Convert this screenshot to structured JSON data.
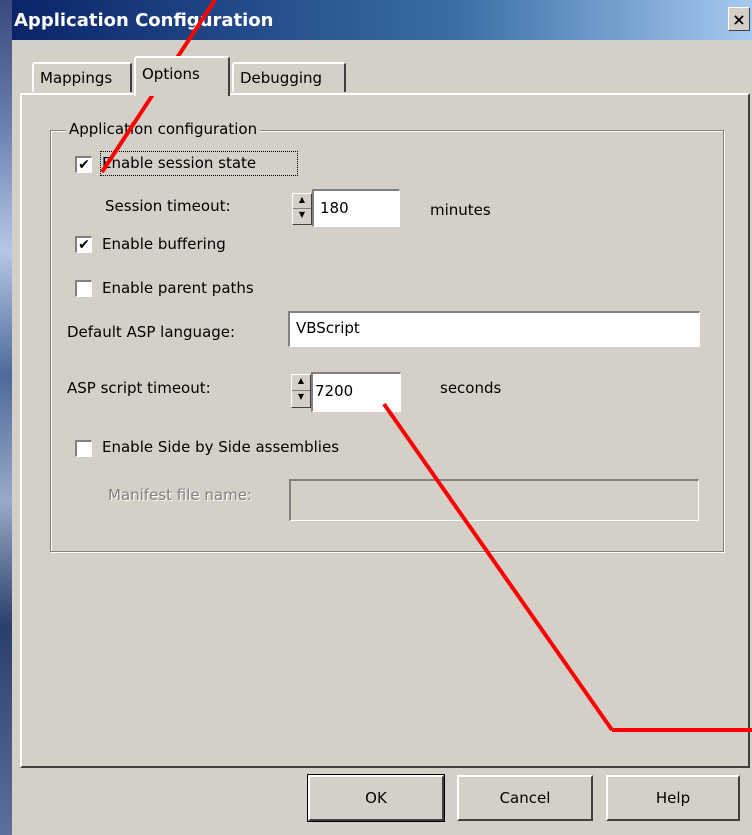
{
  "window": {
    "title": "Application Configuration",
    "close_label": "×"
  },
  "tabs": [
    {
      "label": "Mappings",
      "active": false
    },
    {
      "label": "Options",
      "active": true
    },
    {
      "label": "Debugging",
      "active": false
    }
  ],
  "group": {
    "legend": "Application configuration",
    "enable_session_state": {
      "label": "Enable session state",
      "checked": true
    },
    "session_timeout": {
      "label": "Session timeout:",
      "value": "180",
      "unit": "minutes"
    },
    "enable_buffering": {
      "label": "Enable buffering",
      "checked": true
    },
    "enable_parent_paths": {
      "label": "Enable parent paths",
      "checked": false
    },
    "default_asp_language": {
      "label": "Default ASP language:",
      "value": "VBScript"
    },
    "asp_script_timeout": {
      "label": "ASP script timeout:",
      "value": "7200",
      "unit": "seconds"
    },
    "enable_side_by_side": {
      "label": "Enable Side by Side assemblies",
      "checked": false
    },
    "manifest_file_name": {
      "label": "Manifest file name:",
      "value": ""
    }
  },
  "buttons": {
    "ok": "OK",
    "cancel": "Cancel",
    "help": "Help"
  },
  "colors": {
    "annotation": "#ff0000",
    "titlebar": "#0a246a"
  }
}
